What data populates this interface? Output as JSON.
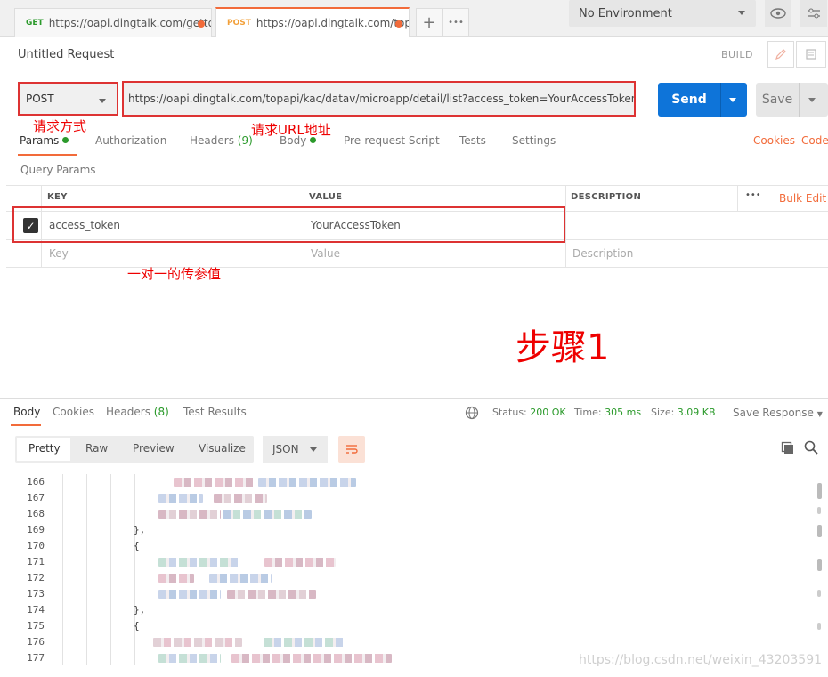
{
  "tabs": [
    {
      "method": "GET",
      "url": "https://oapi.dingtalk.com/getto..."
    },
    {
      "method": "POST",
      "url": "https://oapi.dingtalk.com/topa..."
    }
  ],
  "environment": "No Environment",
  "request": {
    "title": "Untitled Request",
    "build_label": "BUILD",
    "method": "POST",
    "url": "https://oapi.dingtalk.com/topapi/kac/datav/microapp/detail/list?access_token=YourAccessToken",
    "send_label": "Send",
    "save_label": "Save"
  },
  "annotations": {
    "method": "请求方式",
    "url": "请求URL地址",
    "params": "一对一的传参值",
    "step": "步骤1"
  },
  "request_tabs": {
    "params": "Params",
    "authorization": "Authorization",
    "headers": "Headers",
    "headers_count": "(9)",
    "body": "Body",
    "prerequest": "Pre-request Script",
    "tests": "Tests",
    "settings": "Settings",
    "cookies": "Cookies",
    "code": "Code"
  },
  "query_params": {
    "title": "Query Params",
    "headers": {
      "key": "KEY",
      "value": "VALUE",
      "description": "DESCRIPTION"
    },
    "more": "•••",
    "bulk_edit": "Bulk Edit",
    "rows": [
      {
        "key": "access_token",
        "value": "YourAccessToken"
      }
    ],
    "placeholders": {
      "key": "Key",
      "value": "Value",
      "description": "Description"
    }
  },
  "response": {
    "tabs": {
      "body": "Body",
      "cookies": "Cookies",
      "headers": "Headers",
      "headers_count": "(8)",
      "test_results": "Test Results"
    },
    "status_label": "Status:",
    "status": "200 OK",
    "time_label": "Time:",
    "time": "305 ms",
    "size_label": "Size:",
    "size": "3.09 KB",
    "save_response": "Save Response",
    "views": {
      "pretty": "Pretty",
      "raw": "Raw",
      "preview": "Preview",
      "visualize": "Visualize"
    },
    "format": "JSON",
    "lines": [
      {
        "n": "166",
        "t": ""
      },
      {
        "n": "167",
        "t": ""
      },
      {
        "n": "168",
        "t": ""
      },
      {
        "n": "169",
        "t": "},"
      },
      {
        "n": "170",
        "t": "{"
      },
      {
        "n": "171",
        "t": ""
      },
      {
        "n": "172",
        "t": ""
      },
      {
        "n": "173",
        "t": ""
      },
      {
        "n": "174",
        "t": "},"
      },
      {
        "n": "175",
        "t": "{"
      },
      {
        "n": "176",
        "t": ""
      },
      {
        "n": "177",
        "t": ""
      }
    ]
  },
  "watermark": "https://blog.csdn.net/weixin_43203591",
  "colors": {
    "accent": "#f26b3a",
    "send": "#0e74d9",
    "annotation": "#ee0000",
    "success": "#2b9a2b"
  }
}
